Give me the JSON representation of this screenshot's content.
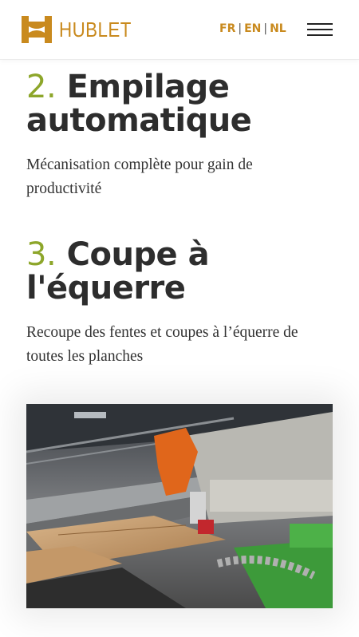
{
  "header": {
    "brand": "HUBLET",
    "languages": [
      "FR",
      "EN",
      "NL"
    ],
    "separator": "|"
  },
  "steps": [
    {
      "number": "2.",
      "title_line1": "Empilage",
      "title_line2": "automatique",
      "description": "Mécanisation complète pour gain de productivité"
    },
    {
      "number": "3.",
      "title_line1": "Coupe à",
      "title_line2": "l'équerre",
      "description": "Recoupe des fentes et coupes à l’équerre de toutes les planches"
    }
  ],
  "colors": {
    "brand": "#c98a1e",
    "accent_number": "#8da62a",
    "text": "#2d2d2d"
  },
  "icons": {
    "menu": "hamburger-icon",
    "logo": "hublet-h-logo-icon"
  }
}
